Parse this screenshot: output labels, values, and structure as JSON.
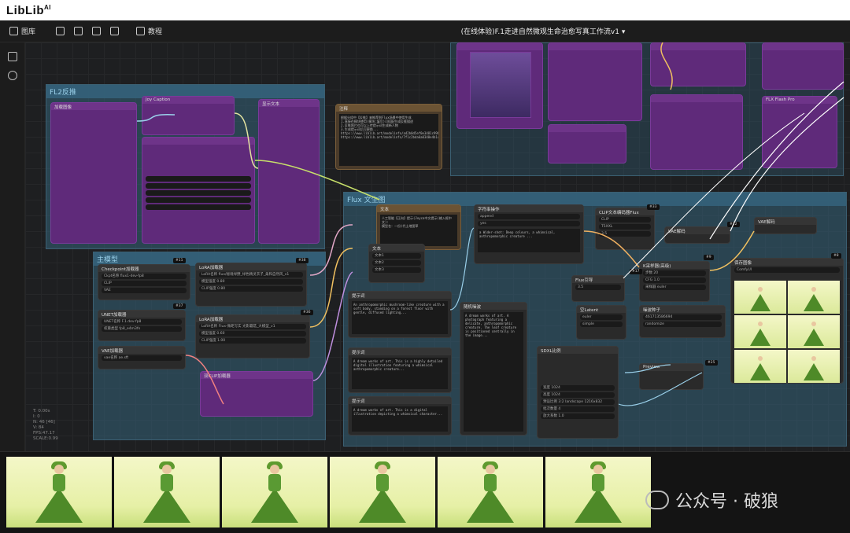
{
  "app": {
    "logo": "LibLib",
    "logo_sup": "AI"
  },
  "toolbar": {
    "library_label": "图库",
    "tutorial_label": "教程",
    "workflow_title": "(在线体验)F.1走进自然微观生命治愈写真工作流v1",
    "title_dropdown": "▾"
  },
  "groups": {
    "flux_lora": "FL2反推",
    "main_model": "主模型",
    "flux_gen": "Flux 文生图"
  },
  "nodes": {
    "note_title": "注释",
    "note_text": "根据分组中【反推】来推荐到Flux场景中使用生成\n1.直接在模块使用(模块:填写)可搭配生成反推描述\n2.反推照片也可以上传提示词生成新人物\n3.生成提示词后可更换...\nhttps://www.liblib.art/modelinfo/a42b0d5ef0e3481c99b48c046d4b0c52\nhttps://www.liblib.art/modelinfo/7f1c2bda6a0348e4b1c5a0da2e0f1b9c",
    "translate_title": "文本",
    "translate_text": "人工智能【正向】提示(Joyca中文提示(输入框中文):\n模型名：一份)代土地图草",
    "ckpt_title": "Checkpoint加载器",
    "ckpt_rows": [
      "Ckpt名称  flux1-dev-fp8",
      "CLIP",
      "VAE"
    ],
    "lora1_title": "LoRA加载器",
    "lora1_rows": [
      "LoRA名称 flux/秘境绿野_绿色精灵衣子_柔和自然风_v1",
      "模型强度 0.80",
      "CLIP强度 0.80"
    ],
    "unet_title": "UNET加载器",
    "unet_rows": [
      "UNET名称 F.1.dev-fp8",
      "权重类型 fp8_e4m3fn"
    ],
    "lora2_title": "LoRA加载器",
    "lora2_rows": [
      "LoRA名称 Flux-微距写实 光影蘑菇_大模型_v1",
      "模型强度 0.60",
      "CLIP强度 1.00"
    ],
    "vae_title": "VAE加载器",
    "vae_rows": [
      "vae名称 ae.sft"
    ],
    "clip_title": "双CLIP加载器",
    "text_node_title": "文本",
    "prompt_title": "提示词",
    "positive_title": "CLIP文本编码器Flux",
    "positive_guidance": "3.5",
    "sampler_title": "K采样器(高级)",
    "sampler_rows": [
      "噪波种子",
      "步数 20",
      "CFG 1.0",
      "采样器 euler",
      "调度器 simple"
    ],
    "vae_decode": "VAE解码",
    "save_image": "保存图像",
    "sdxl_ratio_title": "SDXL比例",
    "sdxl_rows": [
      "宽度 1024",
      "高度 1024",
      "预设比例 3:2 landscape 1216x832",
      "批次数量 4",
      "放大系数 1.0"
    ],
    "flux_guidance": "Flux引导",
    "empty_latent": "空Latent",
    "random_noise": "随机噪波",
    "text_one": "文本1",
    "text_two": "文本2",
    "text_three": "文本3",
    "string_function": "字符串操作",
    "badges": [
      "#31",
      "#38",
      "#37",
      "#36",
      "#33",
      "#22",
      "#17",
      "#11",
      "#9",
      "#8",
      "#25"
    ]
  },
  "stats": [
    "T: 0.00s",
    "I: 0",
    "N: 46 [46]",
    "V: 84",
    "FPS:47.17",
    "SCALE:0.99"
  ],
  "watermark": "公众号 · 破狼"
}
